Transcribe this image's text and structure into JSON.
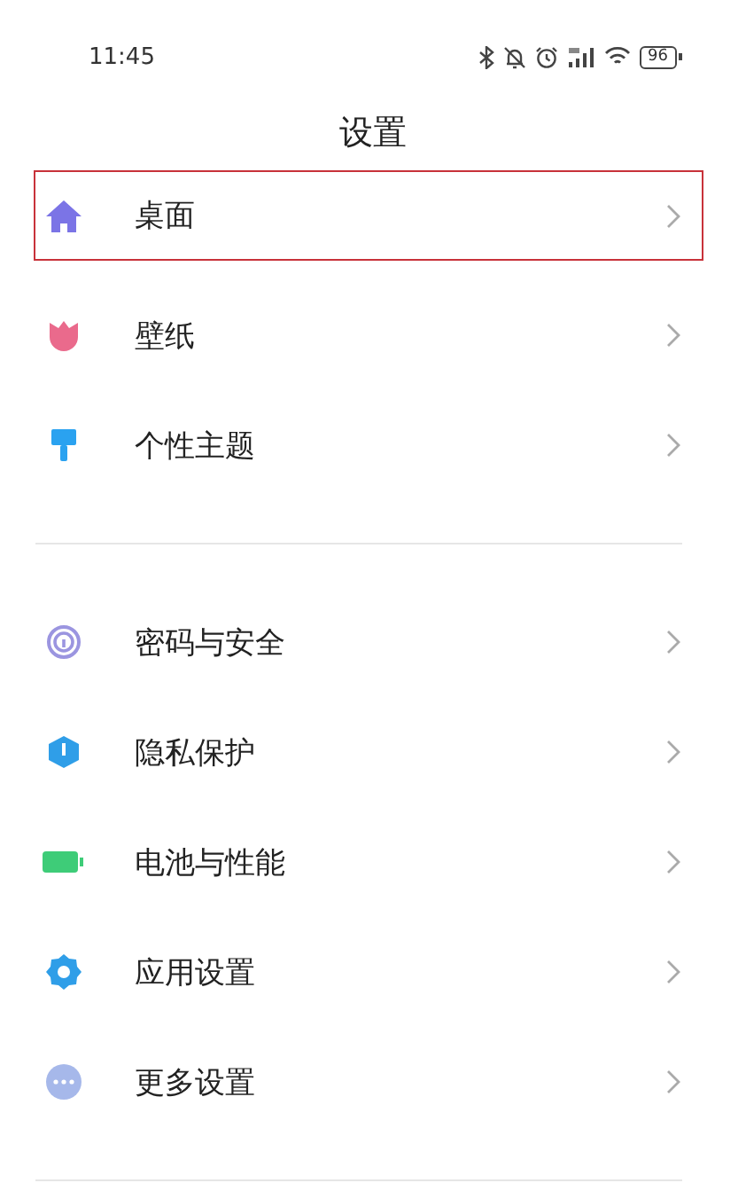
{
  "status_bar": {
    "time": "11:45",
    "battery": "96"
  },
  "title": "设置",
  "groups": [
    {
      "items": [
        {
          "label": "桌面",
          "highlighted": true
        },
        {
          "label": "壁纸",
          "highlighted": false
        },
        {
          "label": "个性主题",
          "highlighted": false
        }
      ]
    },
    {
      "items": [
        {
          "label": "密码与安全",
          "highlighted": false
        },
        {
          "label": "隐私保护",
          "highlighted": false
        },
        {
          "label": "电池与性能",
          "highlighted": false
        },
        {
          "label": "应用设置",
          "highlighted": false
        },
        {
          "label": "更多设置",
          "highlighted": false
        }
      ]
    }
  ]
}
